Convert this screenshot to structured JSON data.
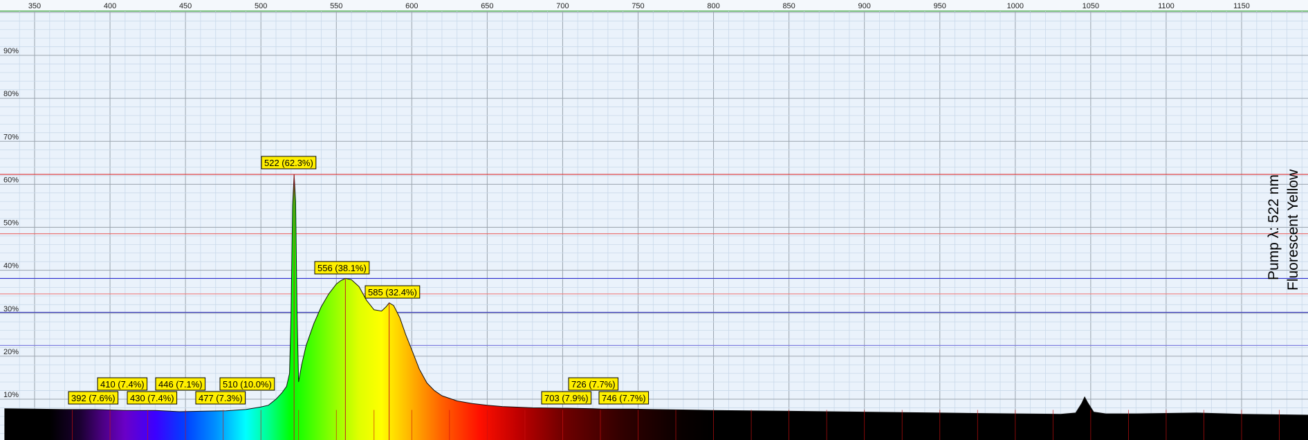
{
  "chart_data": {
    "type": "area",
    "xlim": [
      330,
      1195
    ],
    "ylim": [
      0,
      100
    ],
    "x_ticks": [
      350,
      400,
      450,
      500,
      550,
      600,
      650,
      700,
      750,
      800,
      850,
      900,
      950,
      1000,
      1050,
      1100,
      1150
    ],
    "y_ticks": [
      "10%",
      "20%",
      "30%",
      "40%",
      "50%",
      "60%",
      "70%",
      "80%",
      "90%"
    ],
    "y_tick_values": [
      10,
      20,
      30,
      40,
      50,
      60,
      70,
      80,
      90
    ],
    "grid": true,
    "side_labels": [
      "Pump λ: 522 nm",
      "Fluorescent Yellow"
    ],
    "series": [
      {
        "x": [
          330,
          350,
          370,
          390,
          410,
          430,
          446,
          460,
          477,
          490,
          500,
          505,
          510,
          514,
          517,
          519,
          520,
          521,
          522,
          523,
          524,
          525,
          527,
          530,
          535,
          540,
          545,
          550,
          553,
          556,
          560,
          565,
          570,
          575,
          580,
          583,
          585,
          588,
          592,
          596,
          600,
          605,
          610,
          615,
          620,
          630,
          640,
          650,
          660,
          680,
          700,
          703,
          720,
          726,
          746,
          760,
          780,
          800,
          850,
          900,
          950,
          1000,
          1030,
          1040,
          1044,
          1046,
          1048,
          1052,
          1060,
          1080,
          1100,
          1120,
          1150,
          1195
        ],
        "values": [
          7.8,
          7.7,
          7.6,
          7.6,
          7.4,
          7.4,
          7.1,
          7.2,
          7.3,
          7.6,
          8.2,
          8.6,
          10.0,
          11.5,
          13.0,
          16.0,
          30.0,
          55.0,
          62.3,
          56.0,
          30.0,
          14.0,
          18.0,
          22.5,
          27.5,
          31.5,
          34.5,
          36.8,
          37.6,
          38.1,
          37.8,
          36.2,
          33.0,
          30.8,
          30.5,
          31.5,
          32.4,
          31.8,
          29.0,
          25.0,
          21.5,
          17.0,
          13.8,
          12.0,
          10.8,
          9.6,
          9.0,
          8.6,
          8.3,
          8.0,
          7.9,
          7.9,
          7.8,
          7.7,
          7.7,
          7.6,
          7.5,
          7.4,
          7.2,
          7.0,
          6.8,
          6.6,
          6.5,
          6.8,
          9.0,
          10.5,
          9.2,
          7.0,
          6.6,
          6.6,
          6.7,
          6.8,
          6.5,
          6.3
        ]
      }
    ],
    "annotations": [
      {
        "label": "522 (62.3%)",
        "x": 522,
        "y": 62.3
      },
      {
        "label": "556 (38.1%)",
        "x": 556,
        "y": 38.1
      },
      {
        "label": "585 (32.4%)",
        "x": 585,
        "y": 32.4
      },
      {
        "label": "392 (7.6%)",
        "x": 392,
        "y": 7.6
      },
      {
        "label": "410 (7.4%)",
        "x": 410,
        "y": 7.4
      },
      {
        "label": "430 (7.4%)",
        "x": 430,
        "y": 7.4
      },
      {
        "label": "446 (7.1%)",
        "x": 446,
        "y": 7.1
      },
      {
        "label": "477 (7.3%)",
        "x": 477,
        "y": 7.3
      },
      {
        "label": "510 (10.0%)",
        "x": 510,
        "y": 10.0
      },
      {
        "label": "703 (7.9%)",
        "x": 703,
        "y": 7.9
      },
      {
        "label": "726 (7.7%)",
        "x": 726,
        "y": 7.7
      },
      {
        "label": "746 (7.7%)",
        "x": 746,
        "y": 7.7
      }
    ],
    "hlines": [
      {
        "y": 62.3,
        "color": "#e03030"
      },
      {
        "y": 48.5,
        "color": "#e86060"
      },
      {
        "y": 38.1,
        "color": "#3030d0"
      },
      {
        "y": 34.5,
        "color": "#f08080"
      },
      {
        "y": 30.2,
        "color": "#4040c0"
      },
      {
        "y": 22.5,
        "color": "#8080e0"
      }
    ],
    "vlines": [
      {
        "x": 522,
        "color": "#c02020"
      },
      {
        "x": 556,
        "color": "#c02020"
      },
      {
        "x": 585,
        "color": "#c02020"
      }
    ],
    "colors": {
      "background": "#eaf2fb",
      "grid_minor": "#c9d9ea",
      "grid_major": "#9aa4ae",
      "axis_top": "#5ab55a",
      "label_bg": "#ffef00",
      "label_border": "#000000",
      "curve_line": "#111111"
    }
  }
}
